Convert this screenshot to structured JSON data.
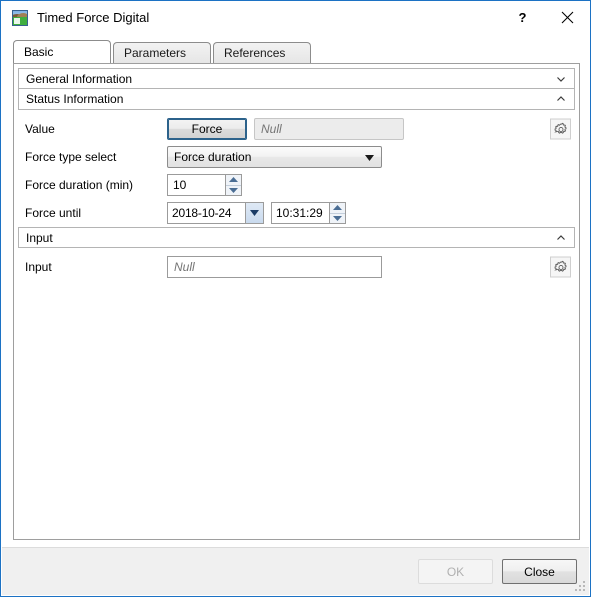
{
  "window": {
    "title": "Timed Force Digital",
    "icon": "image-landscape-icon",
    "help_label": "?",
    "close_label": "✕"
  },
  "tabs": [
    {
      "label": "Basic",
      "active": true
    },
    {
      "label": "Parameters",
      "active": false
    },
    {
      "label": "References",
      "active": false
    }
  ],
  "groups": {
    "general_information": {
      "title": "General Information",
      "expanded": false,
      "chevron": "chevron-down-icon"
    },
    "status_information": {
      "title": "Status Information",
      "expanded": true,
      "chevron": "chevron-up-icon"
    },
    "input": {
      "title": "Input",
      "expanded": true,
      "chevron": "chevron-up-icon"
    }
  },
  "fields": {
    "value": {
      "label": "Value",
      "button_label": "Force",
      "text_value": "",
      "text_placeholder": "Null",
      "gear": "gear-icon"
    },
    "force_type_select": {
      "label": "Force type select",
      "value": "Force duration",
      "options": [
        "Force duration"
      ]
    },
    "force_duration": {
      "label": "Force duration (min)",
      "value": "10"
    },
    "force_until": {
      "label": "Force until",
      "date_value": "2018-10-24",
      "time_value": "10:31:29"
    },
    "input": {
      "label": "Input",
      "text_value": "",
      "text_placeholder": "Null",
      "gear": "gear-icon"
    }
  },
  "footer": {
    "ok_label": "OK",
    "close_label": "Close",
    "ok_enabled": false
  },
  "colors": {
    "window_border": "#1c72c4",
    "placeholder_blue": "#5b8fc9",
    "footer_bg": "#f0f0f0"
  }
}
